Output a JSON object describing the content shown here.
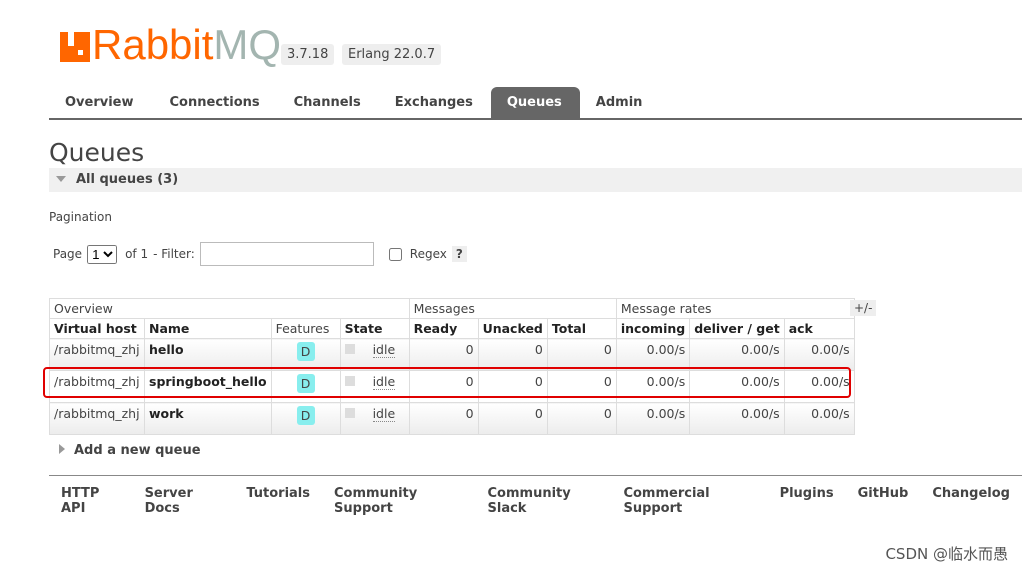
{
  "header": {
    "logo_text_1": "Rabbit",
    "logo_text_2": "MQ",
    "version": "3.7.18",
    "erlang": "Erlang 22.0.7"
  },
  "tabs": [
    {
      "label": "Overview"
    },
    {
      "label": "Connections"
    },
    {
      "label": "Channels"
    },
    {
      "label": "Exchanges"
    },
    {
      "label": "Queues",
      "active": true
    },
    {
      "label": "Admin"
    }
  ],
  "page_title": "Queues",
  "section_title": "All queues (3)",
  "pagination": {
    "label": "Pagination",
    "page_label": "Page",
    "page_value": "1",
    "of_label": "of 1",
    "filter_label": "- Filter:",
    "filter_value": "",
    "regex_label": "Regex",
    "help": "?"
  },
  "table": {
    "groups": [
      "Overview",
      "Messages",
      "Message rates"
    ],
    "plusminus": "+/-",
    "columns": [
      "Virtual host",
      "Name",
      "Features",
      "State",
      "Ready",
      "Unacked",
      "Total",
      "incoming",
      "deliver / get",
      "ack"
    ],
    "rows": [
      {
        "vhost": "/rabbitmq_zhj",
        "name": "hello",
        "feature": "D",
        "state": "idle",
        "ready": "0",
        "unacked": "0",
        "total": "0",
        "incoming": "0.00/s",
        "deliver": "0.00/s",
        "ack": "0.00/s"
      },
      {
        "vhost": "/rabbitmq_zhj",
        "name": "springboot_hello",
        "feature": "D",
        "state": "idle",
        "ready": "0",
        "unacked": "0",
        "total": "0",
        "incoming": "0.00/s",
        "deliver": "0.00/s",
        "ack": "0.00/s",
        "highlighted": true
      },
      {
        "vhost": "/rabbitmq_zhj",
        "name": "work",
        "feature": "D",
        "state": "idle",
        "ready": "0",
        "unacked": "0",
        "total": "0",
        "incoming": "0.00/s",
        "deliver": "0.00/s",
        "ack": "0.00/s"
      }
    ],
    "highlight_color": "#e00000"
  },
  "add_queue": "Add a new queue",
  "footer": [
    "HTTP API",
    "Server Docs",
    "Tutorials",
    "Community Support",
    "Community Slack",
    "Commercial Support",
    "Plugins",
    "GitHub",
    "Changelog"
  ],
  "watermark": "CSDN @临水而愚"
}
